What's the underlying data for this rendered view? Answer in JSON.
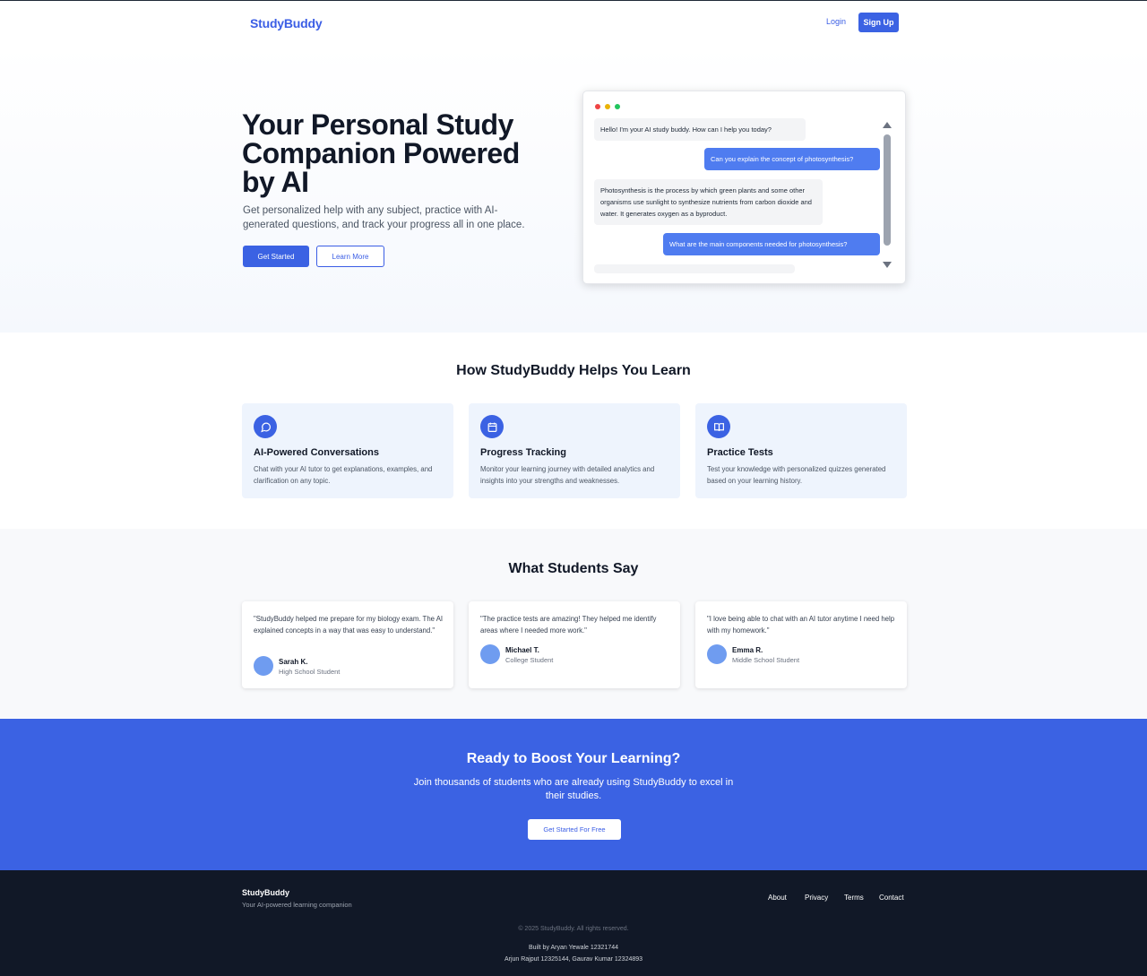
{
  "header": {
    "logo": "StudyBuddy",
    "login": "Login",
    "signup": "Sign Up"
  },
  "hero": {
    "title": "Your Personal Study Companion Powered by AI",
    "subtitle": "Get personalized help with any subject, practice with AI-generated questions, and track your progress all in one place.",
    "primary_button": "Get Started",
    "secondary_button": "Learn More"
  },
  "chat": {
    "messages": [
      {
        "role": "bot",
        "text": "Hello! I'm your AI study buddy. How can I help you today?"
      },
      {
        "role": "user",
        "text": "Can you explain the concept of photosynthesis?"
      },
      {
        "role": "bot",
        "text": "Photosynthesis is the process by which green plants and some other organisms use sunlight to synthesize nutrients from carbon dioxide and water. It generates oxygen as a byproduct."
      },
      {
        "role": "user",
        "text": "What are the main components needed for photosynthesis?"
      }
    ]
  },
  "features": {
    "title": "How StudyBuddy Helps You Learn",
    "items": [
      {
        "icon": "chat-bubble-icon",
        "title": "AI-Powered Conversations",
        "desc": "Chat with your AI tutor to get explanations, examples, and clarification on any topic."
      },
      {
        "icon": "calendar-icon",
        "title": "Progress Tracking",
        "desc": "Monitor your learning journey with detailed analytics and insights into your strengths and weaknesses."
      },
      {
        "icon": "book-icon",
        "title": "Practice Tests",
        "desc": "Test your knowledge with personalized quizzes generated based on your learning history."
      }
    ]
  },
  "testimonials": {
    "title": "What Students Say",
    "items": [
      {
        "quote": "\"StudyBuddy helped me prepare for my biology exam. The AI explained concepts in a way that was easy to understand.\"",
        "name": "Sarah K.",
        "role": "High School Student"
      },
      {
        "quote": "\"The practice tests are amazing! They helped me identify areas where I needed more work.\"",
        "name": "Michael T.",
        "role": "College Student"
      },
      {
        "quote": "\"I love being able to chat with an AI tutor anytime I need help with my homework.\"",
        "name": "Emma R.",
        "role": "Middle School Student"
      }
    ]
  },
  "cta": {
    "title": "Ready to Boost Your Learning?",
    "subtitle": "Join thousands of students who are already using StudyBuddy to excel in their studies.",
    "button": "Get Started For Free"
  },
  "footer": {
    "brand": "StudyBuddy",
    "tagline": "Your AI-powered learning companion",
    "links": [
      "About",
      "Privacy",
      "Terms",
      "Contact"
    ],
    "copyright": "© 2025 StudyBuddy. All rights reserved.",
    "credits_line1": "Built by Aryan Yewale 12321744",
    "credits_line2": "Arjun Rajput 12325144, Gaurav Kumar 12324893"
  },
  "colors": {
    "primary": "#3b62e3",
    "feature_bg": "#eef4fd",
    "footer_bg": "#111827"
  }
}
